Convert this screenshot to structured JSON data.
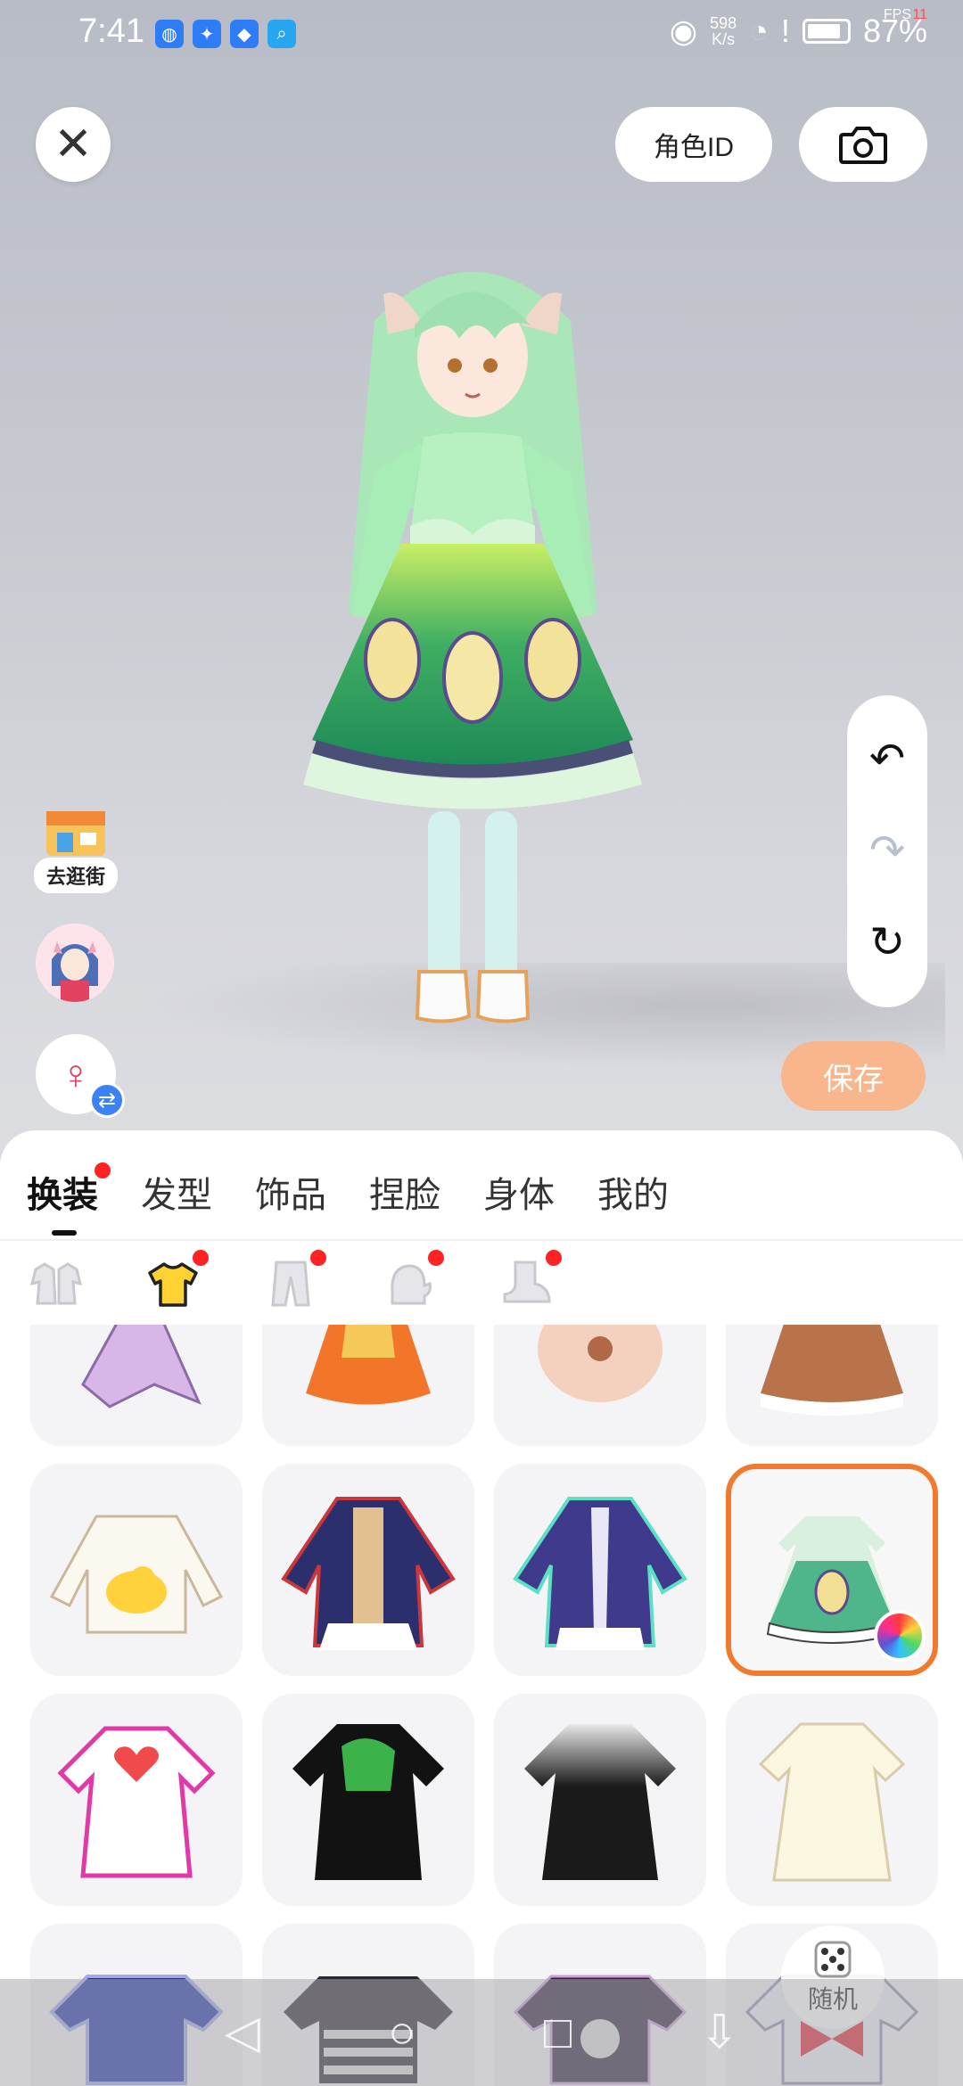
{
  "status_bar": {
    "time": "7:41",
    "speed_value": "598",
    "speed_unit": "K/s",
    "battery": "87%",
    "fps_label": "FPS",
    "fps_value": "11"
  },
  "header": {
    "role_id_label": "角色ID",
    "close_icon": "close-icon",
    "camera_icon": "camera-icon"
  },
  "side": {
    "shop_label": "去逛街",
    "gender_symbol": "♀",
    "swap_symbol": "⇄"
  },
  "history": {
    "undo_icon": "↶",
    "redo_icon": "↷",
    "reset_icon": "↻"
  },
  "save_label": "保存",
  "tabs": [
    {
      "label": "换装",
      "active": true,
      "badge": true
    },
    {
      "label": "发型",
      "active": false,
      "badge": false
    },
    {
      "label": "饰品",
      "active": false,
      "badge": false
    },
    {
      "label": "捏脸",
      "active": false,
      "badge": false
    },
    {
      "label": "身体",
      "active": false,
      "badge": false
    },
    {
      "label": "我的",
      "active": false,
      "badge": false
    }
  ],
  "subcategories": [
    {
      "icon": "suit-icon",
      "badge": false
    },
    {
      "icon": "top-icon",
      "badge": true,
      "active": true
    },
    {
      "icon": "pants-icon",
      "badge": true
    },
    {
      "icon": "glove-icon",
      "badge": true
    },
    {
      "icon": "shoe-icon",
      "badge": true
    }
  ],
  "random_label": "随机",
  "accent_color": "#f07a2e",
  "save_color": "#f9b58c",
  "nav": {
    "back": "◁",
    "home": "○",
    "recent": "□",
    "down": "⇩"
  }
}
